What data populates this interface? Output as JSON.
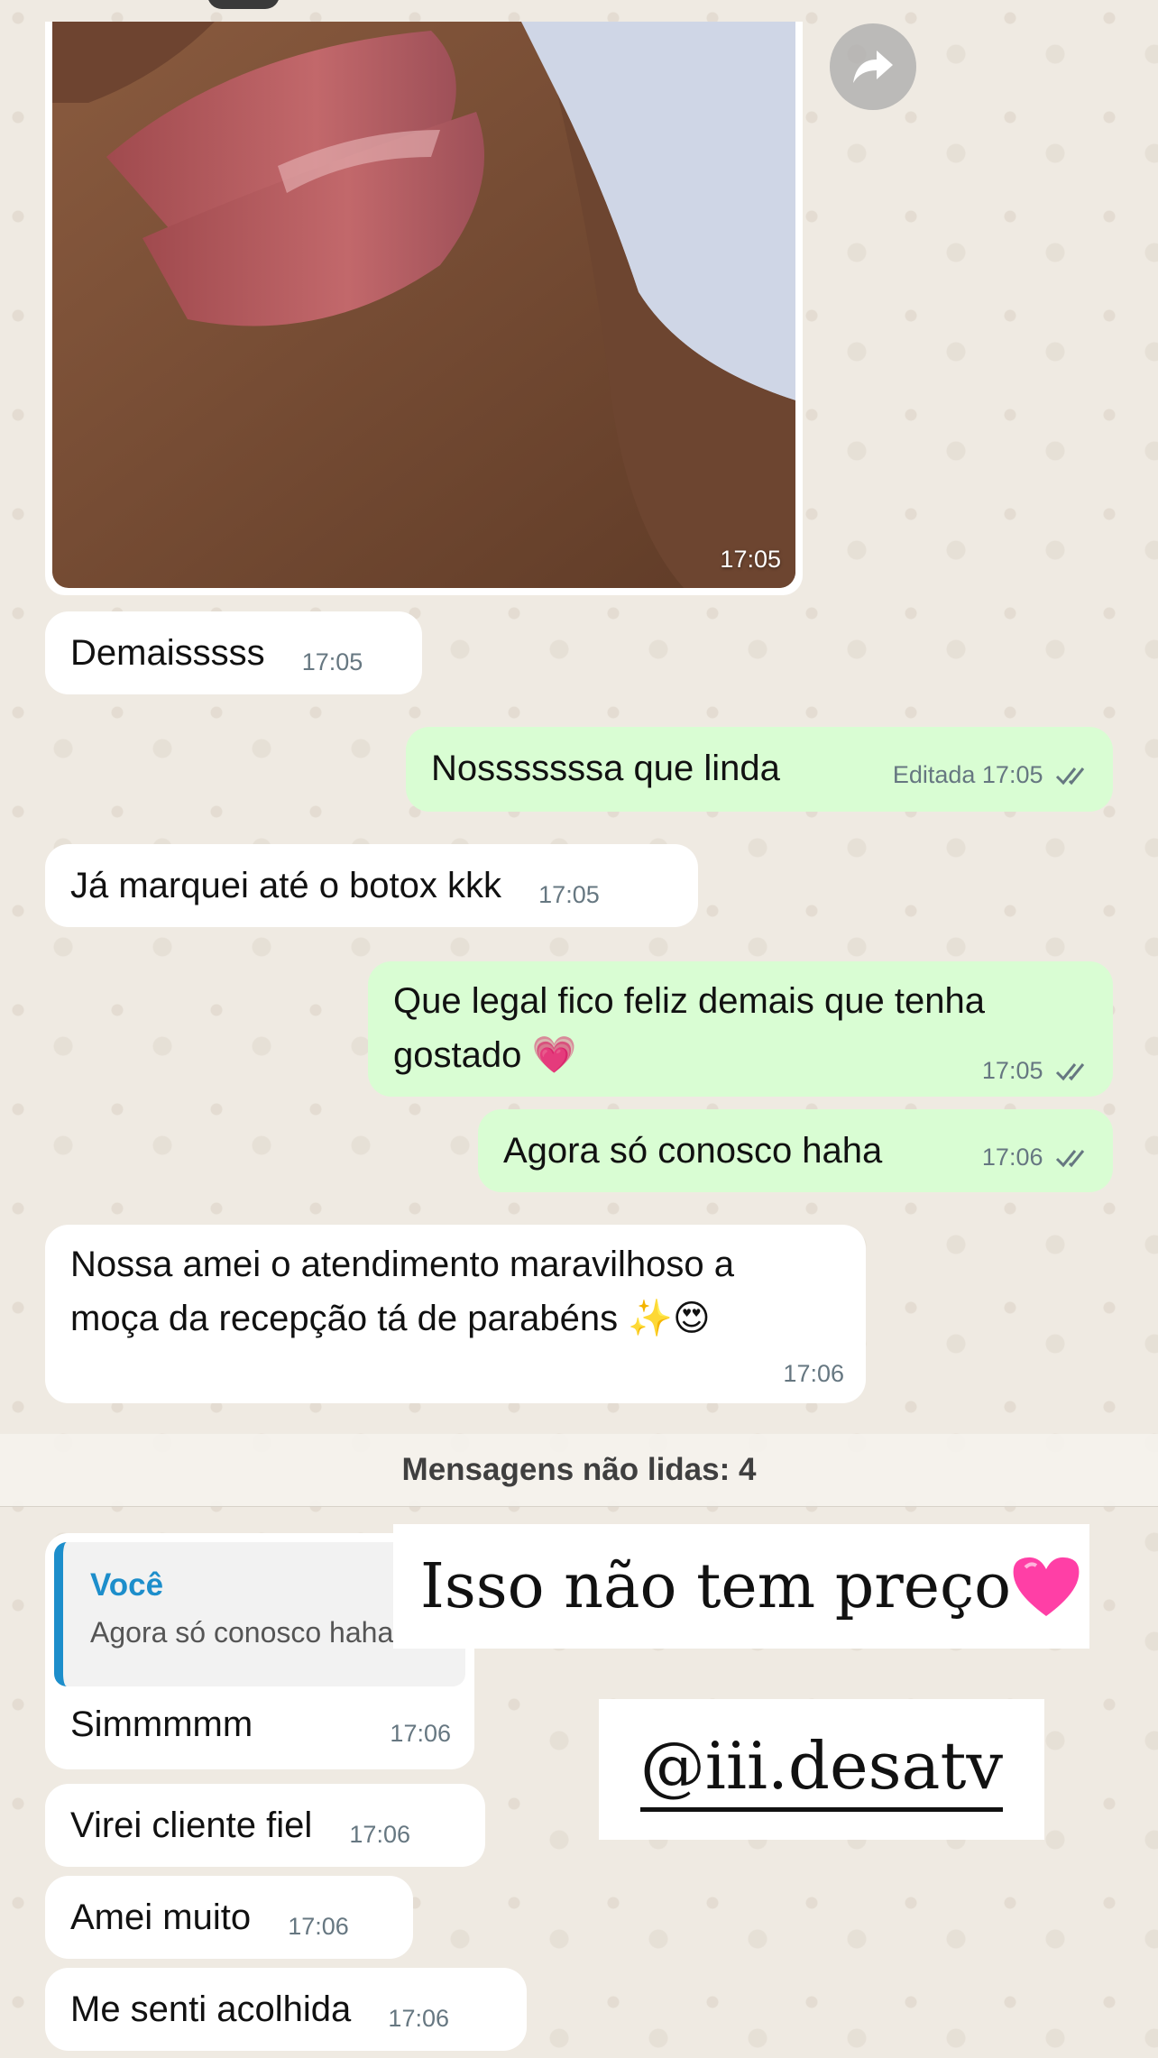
{
  "media": {
    "time": "17:05"
  },
  "messages": [
    {
      "id": "m1",
      "text": "Demaisssss",
      "time": "17:05"
    },
    {
      "id": "m2",
      "text": "Nosssssssa que linda",
      "edited": "Editada",
      "time": "17:05"
    },
    {
      "id": "m3",
      "text": "Já marquei até o botox kkk",
      "time": "17:05"
    },
    {
      "id": "m4",
      "line1": "Que legal fico feliz demais que tenha",
      "line2": "gostado 💗",
      "time": "17:05"
    },
    {
      "id": "m5",
      "text": "Agora só conosco haha",
      "time": "17:06"
    },
    {
      "id": "m6",
      "line1": "Nossa amei o atendimento maravilhoso a",
      "line2": "moça da recepção tá de parabéns ✨😍",
      "time": "17:06"
    }
  ],
  "unread_label": "Mensagens não lidas: 4",
  "reply": {
    "quoted_author": "Você",
    "quoted_text": "Agora só conosco haha",
    "text": "Simmmmm",
    "time": "17:06"
  },
  "more": [
    {
      "text": "Virei cliente fiel",
      "time": "17:06"
    },
    {
      "text": "Amei muito",
      "time": "17:06"
    },
    {
      "text": "Me senti acolhida",
      "time": "17:06"
    }
  ],
  "overlay": {
    "caption": "Isso não tem preço",
    "handle": "@iii.desatv"
  },
  "colors": {
    "incoming": "#ffffff",
    "outgoing": "#d9fdd3",
    "reply_accent": "#1d8ecb",
    "heart": "#ff3fa6"
  },
  "icons": {
    "forward": "forward-arrow-icon",
    "ticks": "double-check-icon",
    "heart": "pink-heart"
  }
}
